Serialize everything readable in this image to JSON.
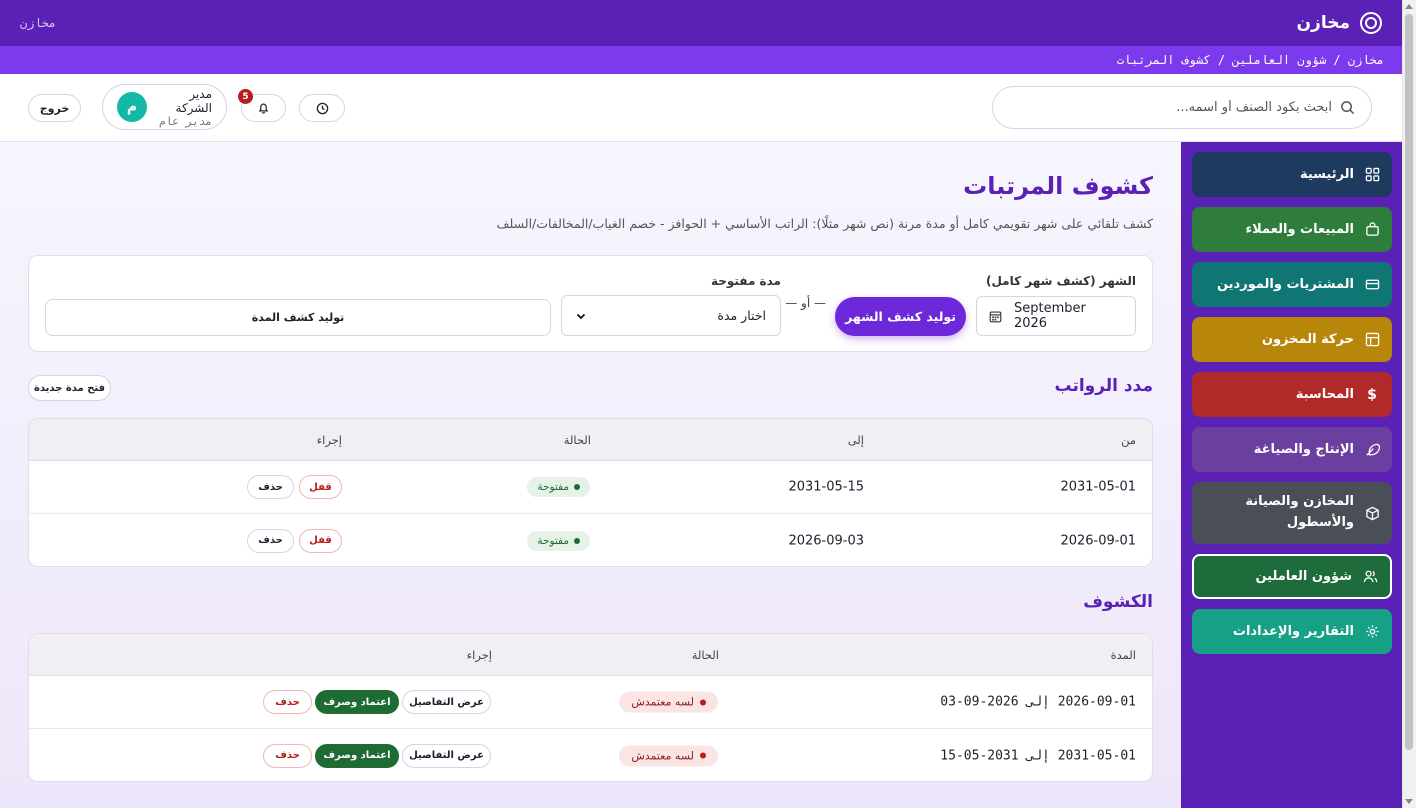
{
  "brand": {
    "name": "مخازن",
    "corner_text": "مخازن"
  },
  "breadcrumb": "مخازن / شؤون العاملين / كشوف المرتبات",
  "search": {
    "placeholder": "ابحث بكود الصنف أو اسمه..."
  },
  "header": {
    "notifications_count": "5",
    "user_name": "مدير الشركة",
    "user_role": "مدير عام",
    "avatar_letter": "م",
    "logout_label": "خروج"
  },
  "sidebar": {
    "items": [
      {
        "label": "الرئيسية",
        "icon": "grid-icon",
        "color": "#1e3a5f"
      },
      {
        "label": "المبيعات والعملاء",
        "icon": "bag-icon",
        "color": "#2f7d3c"
      },
      {
        "label": "المشتريات والموردين",
        "icon": "card-icon",
        "color": "#0f7673"
      },
      {
        "label": "حركة المخزون",
        "icon": "table-icon",
        "color": "#b8860b"
      },
      {
        "label": "المحاسبة",
        "icon": "dollar-icon",
        "color": "#b02a2a"
      },
      {
        "label": "الإنتاج والصياغة",
        "icon": "feather-icon",
        "color": "#6b3fa0"
      },
      {
        "label": "المخازن والصيانة والأسطول",
        "icon": "box-icon",
        "color": "#4a4f57"
      },
      {
        "label": "شؤون العاملين",
        "icon": "users-icon",
        "color": "#1e6b3c"
      },
      {
        "label": "التقارير والإعدادات",
        "icon": "gear-icon",
        "color": "#16a085"
      }
    ]
  },
  "page": {
    "title": "كشوف المرتبات",
    "subtitle": "كشف تلقائي على شهر تقويمي كامل أو مدة مرنة (نص شهر مثلًا): الراتب الأساسي + الحوافز - خصم الغياب/المخالفات/السلف"
  },
  "generator": {
    "month_label": "الشهر (كشف شهر كامل)",
    "month_value": "September 2026",
    "generate_month_label": "توليد كشف الشهر",
    "or_label": "— أو —",
    "period_label": "مدة مفتوحة",
    "period_select": "اختار مدة",
    "generate_period_label": "توليد كشف المدة"
  },
  "periods": {
    "title": "مدد الرواتب",
    "new_period_label": "فتح مدة جديدة",
    "headers": {
      "from": "من",
      "to": "إلى",
      "status": "الحالة",
      "action": "إجراء"
    },
    "rows": [
      {
        "from": "2031-05-01",
        "to": "2031-05-15",
        "status": "مفتوحة",
        "close": "قفل",
        "delete": "حذف"
      },
      {
        "from": "2026-09-01",
        "to": "2026-09-03",
        "status": "مفتوحة",
        "close": "قفل",
        "delete": "حذف"
      }
    ]
  },
  "sheets": {
    "title": "الكشوف",
    "headers": {
      "period": "المدة",
      "status": "الحالة",
      "action": "إجراء"
    },
    "rows": [
      {
        "period": "2026-09-01 إلى 2026-09-03",
        "status": "لسه معتمدش",
        "details": "عرض التفاصيل",
        "approve": "اعتماد وصرف",
        "delete": "حذف"
      },
      {
        "period": "2031-05-01 إلى 2031-05-15",
        "status": "لسه معتمدش",
        "details": "عرض التفاصيل",
        "approve": "اعتماد وصرف",
        "delete": "حذف"
      }
    ]
  }
}
